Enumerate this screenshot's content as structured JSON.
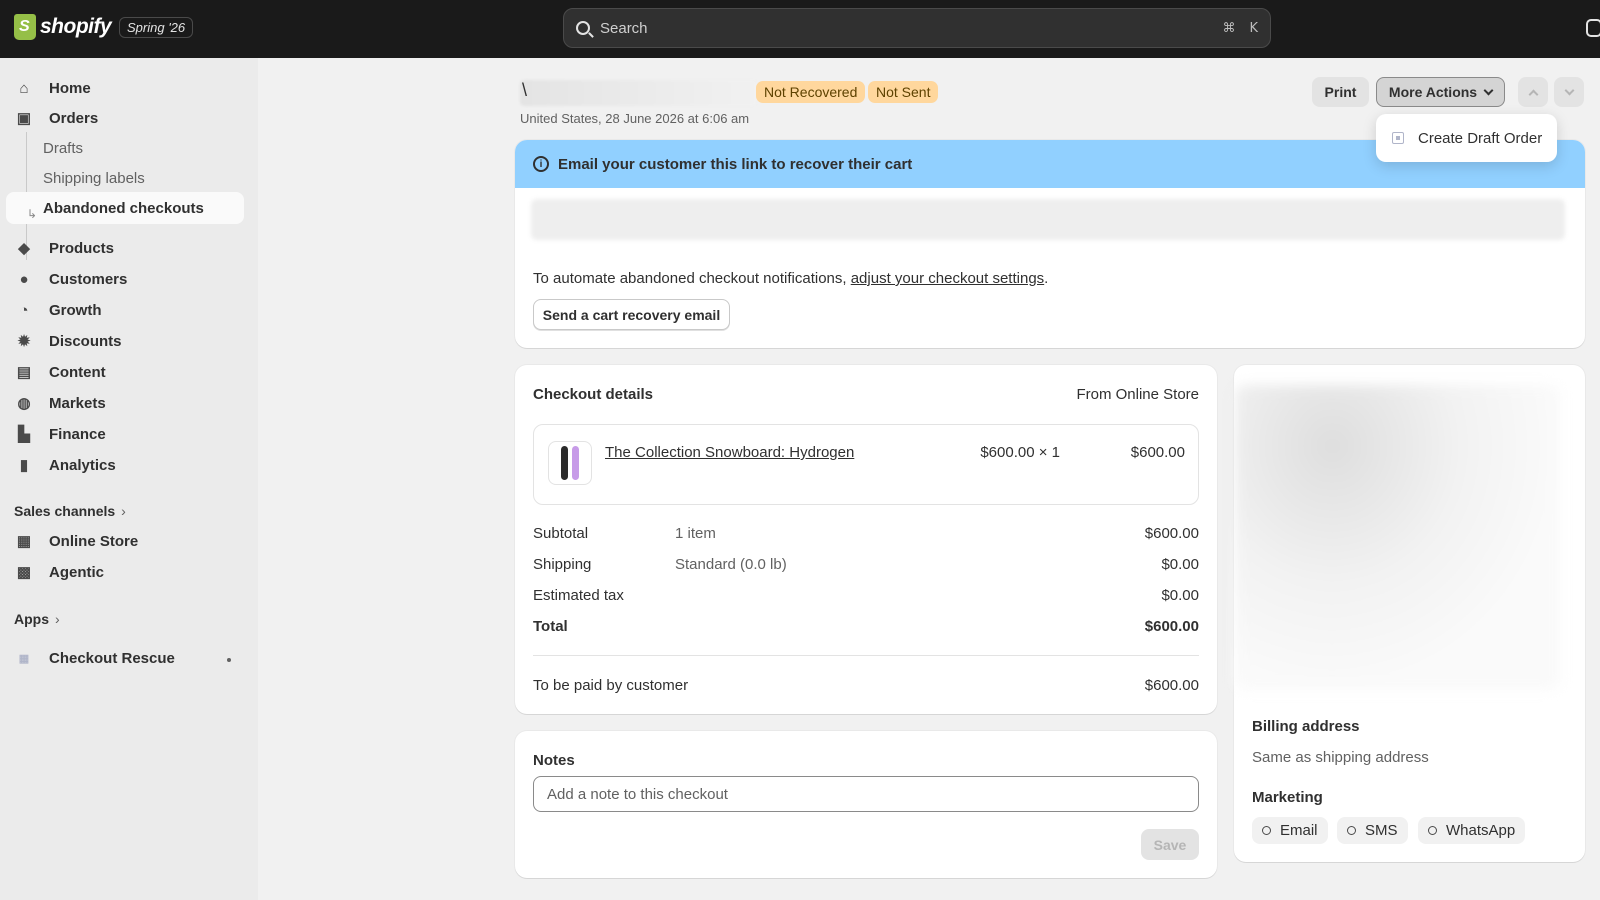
{
  "topbar": {
    "brand": "shopify",
    "edition": "Spring '26",
    "search_placeholder": "Search",
    "shortcut_cmd": "⌘",
    "shortcut_key": "K"
  },
  "sidebar": {
    "home": "Home",
    "orders": "Orders",
    "drafts": "Drafts",
    "shipping_labels": "Shipping labels",
    "abandoned_checkouts": "Abandoned checkouts",
    "products": "Products",
    "customers": "Customers",
    "growth": "Growth",
    "discounts": "Discounts",
    "content": "Content",
    "markets": "Markets",
    "finance": "Finance",
    "analytics": "Analytics",
    "sales_channels": "Sales channels",
    "online_store": "Online Store",
    "agentic": "Agentic",
    "apps": "Apps",
    "checkout_rescue": "Checkout Rescue"
  },
  "header": {
    "title_prefix": "\\",
    "badge_recovery": "Not Recovered",
    "badge_email": "Not Sent",
    "subline": "United States, 28 June 2026 at 6:06 am",
    "print": "Print",
    "more_actions": "More Actions",
    "menu_item": "Create Draft Order"
  },
  "recovery": {
    "banner": "Email your customer this link to recover their cart",
    "automate_text": "To automate abandoned checkout notifications, ",
    "automate_link": "adjust your checkout settings",
    "automate_end": ".",
    "send_button": "Send a cart recovery email"
  },
  "checkout": {
    "title": "Checkout details",
    "source": "From Online Store",
    "item": {
      "name": "The Collection Snowboard: Hydrogen",
      "unit_qty": "$600.00 × 1",
      "line_total": "$600.00"
    },
    "rows": [
      {
        "label": "Subtotal",
        "detail": "1 item",
        "amount": "$600.00"
      },
      {
        "label": "Shipping",
        "detail": "Standard (0.0 lb)",
        "amount": "$0.00"
      },
      {
        "label": "Estimated tax",
        "detail": "",
        "amount": "$0.00"
      },
      {
        "label": "Total",
        "detail": "",
        "amount": "$600.00"
      }
    ],
    "to_be_paid_label": "To be paid by customer",
    "to_be_paid_amount": "$600.00"
  },
  "notes": {
    "title": "Notes",
    "placeholder": "Add a note to this checkout",
    "save": "Save"
  },
  "customer": {
    "billing_title": "Billing address",
    "billing_value": "Same as shipping address",
    "marketing_title": "Marketing",
    "channels": [
      "Email",
      "SMS",
      "WhatsApp"
    ]
  },
  "colors": {
    "topbar": "#1a1a1a",
    "badge": "#ffd79d",
    "banner": "#91d0ff",
    "snowboard_a": "#2b2b2b",
    "snowboard_b": "#c79be8"
  }
}
